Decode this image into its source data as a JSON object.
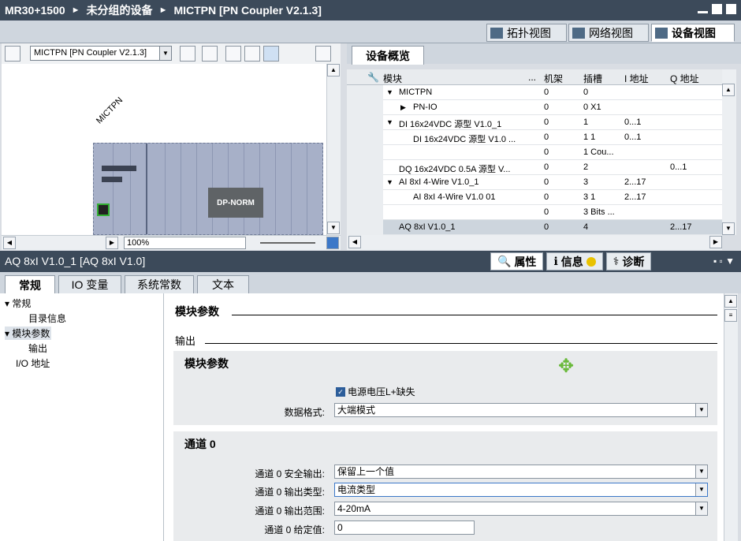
{
  "title": {
    "project": "MR30+1500",
    "group": "未分组的设备",
    "device": "MICTPN [PN Coupler V2.1.3]"
  },
  "view_tabs": [
    "拓扑视图",
    "网络视图",
    "设备视图"
  ],
  "canvas": {
    "device_select": "MICTPN [PN Coupler V2.1.3]",
    "rack_label": "MICTPN",
    "dp_label": "DP-NORM",
    "zoom": "100%"
  },
  "overview": {
    "tab_label": "设备概览",
    "columns": [
      "模块",
      "...",
      "机架",
      "插槽",
      "I 地址",
      "Q 地址"
    ],
    "rows": [
      {
        "module": "MICTPN",
        "rack": "0",
        "slot": "0",
        "i": "",
        "q": ""
      },
      {
        "module": "PN-IO",
        "rack": "0",
        "slot": "0 X1",
        "i": "",
        "q": ""
      },
      {
        "module": "DI 16x24VDC 源型 V1.0_1",
        "rack": "0",
        "slot": "1",
        "i": "0...1",
        "q": ""
      },
      {
        "module": "DI 16x24VDC 源型 V1.0 ...",
        "rack": "0",
        "slot": "1 1",
        "i": "0...1",
        "q": ""
      },
      {
        "module": "",
        "rack": "0",
        "slot": "1 Cou...",
        "i": "",
        "q": ""
      },
      {
        "module": "DQ 16x24VDC 0.5A 源型 V...",
        "rack": "0",
        "slot": "2",
        "i": "",
        "q": "0...1"
      },
      {
        "module": "AI 8xI 4-Wire V1.0_1",
        "rack": "0",
        "slot": "3",
        "i": "2...17",
        "q": ""
      },
      {
        "module": "AI 8xI 4-Wire V1.0 01",
        "rack": "0",
        "slot": "3 1",
        "i": "2...17",
        "q": ""
      },
      {
        "module": "",
        "rack": "0",
        "slot": "3 Bits ...",
        "i": "",
        "q": ""
      },
      {
        "module": "AQ 8xI V1.0_1",
        "rack": "0",
        "slot": "4",
        "i": "",
        "q": "2...17"
      }
    ]
  },
  "properties": {
    "title": "AQ 8xI V1.0_1 [AQ 8xI V1.0]",
    "tabs": [
      "属性",
      "信息",
      "诊断"
    ],
    "subtabs": [
      "常规",
      "IO 变量",
      "系统常数",
      "文本"
    ],
    "nav": [
      "常规",
      "目录信息",
      "模块参数",
      "输出",
      "I/O 地址"
    ],
    "section_title": "模块参数",
    "sub_section": "输出",
    "panel1_title": "模块参数",
    "checkbox_label": "电源电压L+缺失",
    "data_format_label": "数据格式:",
    "data_format_value": "大端模式",
    "panel2_title": "通道 0",
    "fields": [
      {
        "label": "通道 0 安全输出:",
        "value": "保留上一个值"
      },
      {
        "label": "通道 0 输出类型:",
        "value": "电流类型"
      },
      {
        "label": "通道 0 输出范围:",
        "value": "4-20mA"
      },
      {
        "label": "通道 0 给定值:",
        "value": "0"
      }
    ]
  }
}
